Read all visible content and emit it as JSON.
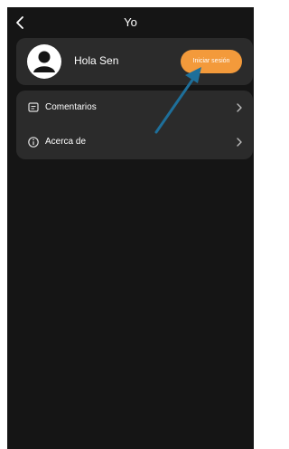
{
  "header": {
    "title": "Yo"
  },
  "profile": {
    "greeting": "Hola Sen",
    "login_label": "Iniciar sesión"
  },
  "menu": {
    "items": [
      {
        "label": "Comentarios",
        "icon": "feedback-icon"
      },
      {
        "label": "Acerca de",
        "icon": "info-icon"
      }
    ]
  },
  "colors": {
    "background": "#151515",
    "card": "#2b2b2b",
    "accent": "#f39a3b",
    "annotation_arrow": "#1e6f9a"
  }
}
